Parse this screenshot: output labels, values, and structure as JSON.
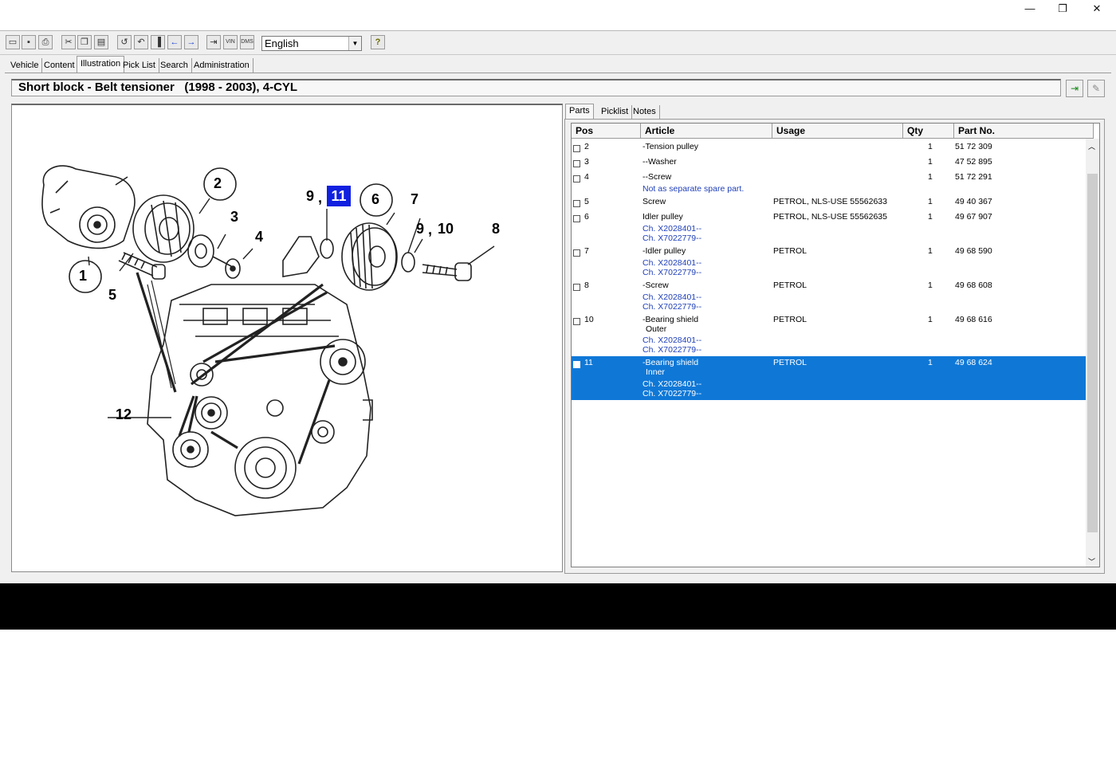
{
  "window": {
    "minimize_icon": "minimize-icon",
    "maximize_icon": "restore-icon",
    "close_icon": "close-icon",
    "minimize_glyph": "—",
    "restore_glyph": "❐",
    "close_glyph": "✕"
  },
  "toolbar": {
    "language": "English",
    "dropdown_glyph": "▼",
    "vin_label": "VIN",
    "dms_label": "DMS",
    "help_glyph": "?"
  },
  "tabs": [
    "Vehicle",
    "Content",
    "Illustration",
    "Pick List",
    "Search",
    "Administration"
  ],
  "header": {
    "title": "Short block - Belt tensioner   (1998 - 2003), 4-CYL"
  },
  "illustration": {
    "callouts": [
      "1",
      "2",
      "3",
      "4",
      "5",
      "6",
      "7",
      "8",
      "9",
      "11",
      "9",
      "10",
      "12"
    ],
    "highlight": "11",
    "separator": ","
  },
  "parts_tabs": [
    "Parts",
    "Picklist",
    "Notes"
  ],
  "parts_table": {
    "columns": [
      "Pos",
      "Article",
      "Usage",
      "Qty",
      "Part No."
    ],
    "rows": [
      {
        "pos": "2",
        "article": "-Tension pulley",
        "usage": "",
        "qty": "1",
        "part_no": "51 72 309",
        "notes": []
      },
      {
        "pos": "3",
        "article": "--Washer",
        "usage": "",
        "qty": "1",
        "part_no": "47 52 895",
        "notes": []
      },
      {
        "pos": "4",
        "article": "--Screw",
        "usage": "",
        "qty": "1",
        "part_no": "51 72 291",
        "notes": [
          "Not as separate spare part."
        ]
      },
      {
        "pos": "5",
        "article": "Screw",
        "usage": "PETROL, NLS-USE 55562633",
        "qty": "1",
        "part_no": "49 40 367",
        "notes": []
      },
      {
        "pos": "6",
        "article": "Idler pulley",
        "usage": "PETROL, NLS-USE 55562635",
        "qty": "1",
        "part_no": "49 67 907",
        "notes": [
          "Ch. X2028401--",
          "Ch. X7022779--"
        ]
      },
      {
        "pos": "7",
        "article": "-Idler pulley",
        "usage": "PETROL",
        "qty": "1",
        "part_no": "49 68 590",
        "notes": [
          "Ch. X2028401--",
          "Ch. X7022779--"
        ]
      },
      {
        "pos": "8",
        "article": "-Screw",
        "usage": "PETROL",
        "qty": "1",
        "part_no": "49 68 608",
        "notes": [
          "Ch. X2028401--",
          "Ch. X7022779--"
        ]
      },
      {
        "pos": "10",
        "article": "-Bearing shield",
        "article2": "Outer",
        "usage": "PETROL",
        "qty": "1",
        "part_no": "49 68 616",
        "notes": [
          "Ch. X2028401--",
          "Ch. X7022779--"
        ]
      },
      {
        "pos": "11",
        "article": "-Bearing shield",
        "article2": "Inner",
        "usage": "PETROL",
        "qty": "1",
        "part_no": "49 68 624",
        "notes": [
          "Ch. X2028401--",
          "Ch. X7022779--"
        ],
        "selected": true
      }
    ]
  },
  "colors": {
    "selection": "#0f78d7",
    "note_text": "#1f3fb8",
    "callout_highlight": "#1020e0"
  }
}
